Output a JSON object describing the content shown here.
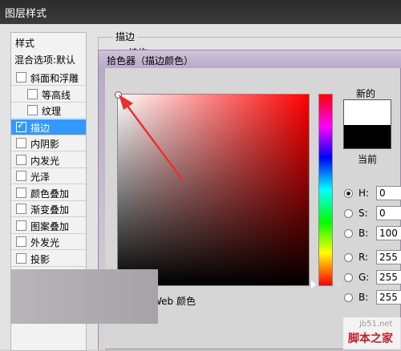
{
  "window": {
    "title": "图层样式"
  },
  "sidebar": {
    "header": "样式",
    "blend_options": "混合选项:默认",
    "items": [
      {
        "label": "斜面和浮雕",
        "checked": false,
        "sub": false
      },
      {
        "label": "等高线",
        "checked": false,
        "sub": true
      },
      {
        "label": "纹理",
        "checked": false,
        "sub": true
      },
      {
        "label": "描边",
        "checked": true,
        "sub": false,
        "active": true
      },
      {
        "label": "内阴影",
        "checked": false,
        "sub": false
      },
      {
        "label": "内发光",
        "checked": false,
        "sub": false
      },
      {
        "label": "光泽",
        "checked": false,
        "sub": false
      },
      {
        "label": "颜色叠加",
        "checked": false,
        "sub": false
      },
      {
        "label": "渐变叠加",
        "checked": false,
        "sub": false
      },
      {
        "label": "图案叠加",
        "checked": false,
        "sub": false
      },
      {
        "label": "外发光",
        "checked": false,
        "sub": false
      },
      {
        "label": "投影",
        "checked": false,
        "sub": false
      }
    ]
  },
  "stroke_panel": {
    "title": "描边",
    "partial_label": "结构"
  },
  "color_picker": {
    "title": "拾色器（描边颜色）",
    "new_label": "新的",
    "current_label": "当前",
    "new_color": "#ffffff",
    "current_color": "#000000",
    "web_colors_label": "Web 颜色",
    "fields": [
      {
        "key": "H:",
        "value": "0",
        "selected": true
      },
      {
        "key": "S:",
        "value": "0",
        "selected": false
      },
      {
        "key": "B:",
        "value": "100",
        "selected": false
      },
      {
        "key": "R:",
        "value": "255",
        "selected": false
      },
      {
        "key": "G:",
        "value": "255",
        "selected": false
      },
      {
        "key": "B:",
        "value": "255",
        "selected": false
      }
    ]
  },
  "watermark": {
    "line1": "jb51.net",
    "line2": "脚本之家"
  }
}
